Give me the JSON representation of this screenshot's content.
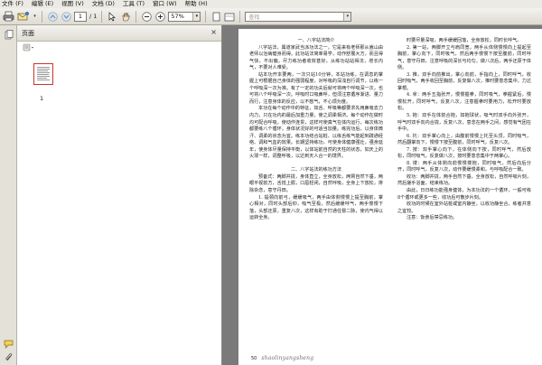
{
  "menu": {
    "items": [
      "文件 (F)",
      "编辑 (E)",
      "视图 (V)",
      "文档 (D)",
      "工具 (T)",
      "窗口 (W)",
      "帮助 (H)"
    ]
  },
  "toolbar": {
    "current_page": "1",
    "page_total": "/ 1",
    "zoom": "57%",
    "search_placeholder": "查找"
  },
  "nav": {
    "title": "页面",
    "close": "×",
    "thumb_page_number": "1"
  },
  "document": {
    "left_column": [
      {
        "type": "h",
        "text": "一、八字站法简介"
      },
      {
        "type": "p",
        "text": "八字站法，属道家武当派功法之一，它是来有老师那从嵩山由老师以治病健身而得。此功站法简单易学，动作舒展大方，而且得气快，不出偏，尽力练功者收效甚好，从练功站站得法，增长内气，不要对人难受。"
      },
      {
        "type": "p",
        "text": "站本功开本要两，一次只站10分钟，本站功练，在调息的掌握上可根据自己身体的强弱程度，对呼吸的深浅自行调节，以练一个呼吸深一次为准。有了一定的功夫后就可将两个呼吸深一次，也可将八个呼吸深一次。呼吸时口吸鼻呼，但须注意循序渐进、量力而行，注意身体的反应，以不憋气，不心烦为度。"
      },
      {
        "type": "p",
        "text": "本功在每个动作中的特征，如舌、呼吸等都要求先用鼻吸去力内力，只在功内的最后加重力量，使之调柔相济。每个动作在做时均可配合呼吸，使动作连贯，这样可使真气在体内运行，每次练功都要练八个循环，身体状况好的可适当加量。练完功后，以身体微汗、调柔的状态为宜。练本功结合站桩、以练舌练气能起到疏通经络、调和气血的效果。长期坚持练功，可使身体健康强壮，强身延年，使身体尽量保持平衡，以体站前自然的天柱的状态，如天上的火球一样，调整呼吸，以达到天人合一的境界。"
      },
      {
        "type": "gap"
      },
      {
        "type": "h",
        "text": "二、八字站法的练功方法"
      },
      {
        "type": "p",
        "text": "预备式：两脚并拢，身体直立，全身放松，两臂自然下垂，两眼平视前方，舌抵上腭，口唇轻闭，自然呼吸，全身上下放松，排除杂念，意守丹田。"
      },
      {
        "type": "p",
        "text": "1. 提颈向前弓，缓缓吸气，两手由体侧慢慢上提至胸前，掌心相对，同时头部后仰，吸气至极，然后缓缓呼气，两手慢慢下落，头部还原，重复八次，这样有助于打通任督二脉，使内气得以运转全身。"
      }
    ],
    "right_column": [
      {
        "type": "p",
        "text": "时要尽量深吸，两手缓缓回落，全身放松，同时长呼气。"
      },
      {
        "type": "p",
        "text": "2. 第一站，两脚开立与肩同宽，两手从体侧慢慢向上提起至胸前，掌心向下，同时吸气，然后两手慢慢下按至腹前，同时呼气，意守丹田，注意呼吸的深长与均匀，做八次后，两手还原于体侧。"
      },
      {
        "type": "p",
        "text": "3. 推，双手向前推出，掌心向前，手指向上，同时呼气，收回时吸气，两手收回至胸前，反复做八次，推时要意念集中，力达掌根。"
      },
      {
        "type": "p",
        "text": "4. 拿：两手五指张开，慢慢握拳，同时吸气，拳握紧后，慢慢松开，同时呼气，反复八次，注意握拳时要用力，松开时要放松。"
      },
      {
        "type": "p",
        "text": "5. 抱：双手在体前合抱，如抱球状，吸气时双手向外张开，呼气时双手向内合拢，反复八次，意念在两手之间，感觉有气团在手中。"
      },
      {
        "type": "p",
        "text": "6. 托：双手掌心向上，由腹前慢慢上托至头顶，同时吸气，然后翻掌向下，慢慢下按至腹前，同时呼气，反复八次。"
      },
      {
        "type": "p",
        "text": "7. 按：双手掌心向下，在体侧向下按，同时呼气，然后放松，同时吸气，反复做八次，按时要意念集中于两掌心。"
      },
      {
        "type": "p",
        "text": "8. 搂：两手从体侧向前慢慢搂抱，同时吸气，然后向后分开，同时呼气，反复八次，动作要缓慢柔和，与呼吸配合一致。"
      },
      {
        "type": "p",
        "text": "收功：两脚并拢，两手自然下垂，全身放松，自然呼吸片刻，然后搓手浴面，结束练功。"
      },
      {
        "type": "p",
        "text": "由此，日日练功能强身健体，为本功法的一个循环，一般可练8个循环或更多一些，收功后可散步片刻。"
      },
      {
        "type": "p",
        "text": "收功的时候在室外站桩或室内静坐，以收功静坐合，练者并意之宜较。"
      },
      {
        "type": "p",
        "text": "注意：饭食后禁忌练功。"
      }
    ],
    "page_number": "50",
    "watermark": "shaolinyangsheng"
  },
  "colors": {
    "accent": "#c9352c",
    "doc_background": "#7a7a7a",
    "toolbar": "#e4e1d9"
  }
}
